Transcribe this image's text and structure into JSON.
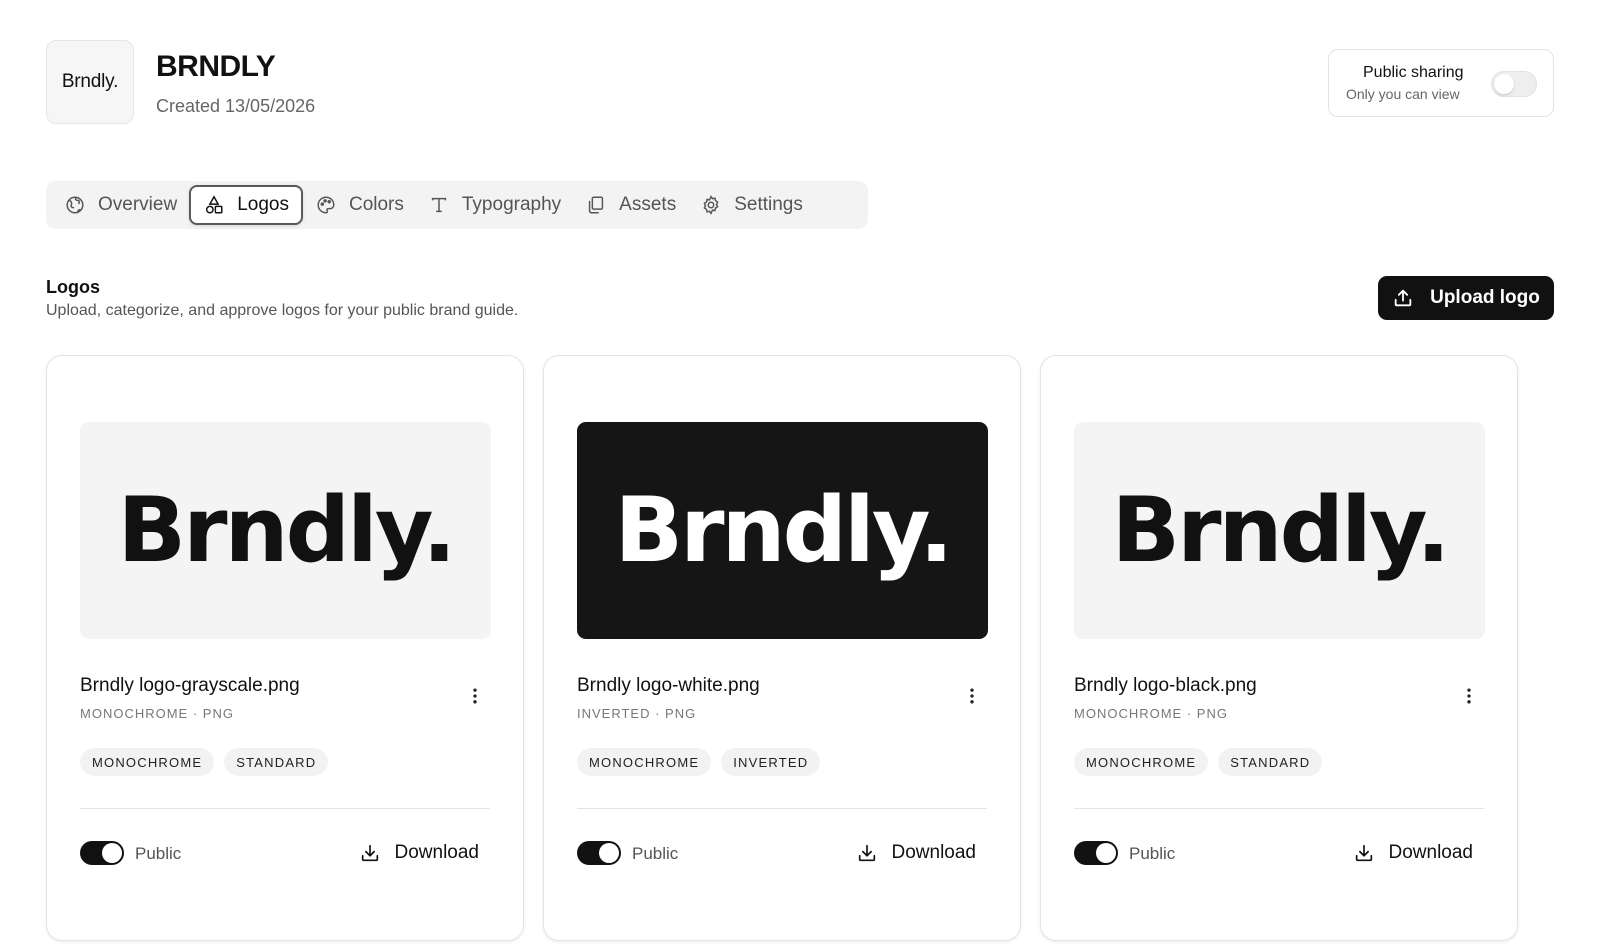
{
  "header": {
    "avatar_text": "Brndly.",
    "title": "BRNDLY",
    "created": "Created 13/05/2026"
  },
  "sharing": {
    "title": "Public sharing",
    "subtitle": "Only you can view",
    "enabled": false
  },
  "tabs": [
    {
      "label": "Overview",
      "icon": "globe-icon",
      "active": false
    },
    {
      "label": "Logos",
      "icon": "shapes-icon",
      "active": true
    },
    {
      "label": "Colors",
      "icon": "palette-icon",
      "active": false
    },
    {
      "label": "Typography",
      "icon": "type-icon",
      "active": false
    },
    {
      "label": "Assets",
      "icon": "copy-icon",
      "active": false
    },
    {
      "label": "Settings",
      "icon": "gear-icon",
      "active": false
    }
  ],
  "section": {
    "title": "Logos",
    "description": "Upload, categorize, and approve logos for your public brand guide.",
    "upload_label": "Upload logo"
  },
  "cards": [
    {
      "preview_text": "Brndly.",
      "preview_theme": "light",
      "file_name": "Brndly logo-grayscale.png",
      "meta": "MONOCHROME  · PNG",
      "tags": [
        "MONOCHROME",
        "STANDARD"
      ],
      "public_label": "Public",
      "public": true,
      "download_label": "Download"
    },
    {
      "preview_text": "Brndly.",
      "preview_theme": "dark",
      "file_name": "Brndly logo-white.png",
      "meta": "INVERTED  · PNG",
      "tags": [
        "MONOCHROME",
        "INVERTED"
      ],
      "public_label": "Public",
      "public": true,
      "download_label": "Download"
    },
    {
      "preview_text": "Brndly.",
      "preview_theme": "light",
      "file_name": "Brndly logo-black.png",
      "meta": "MONOCHROME  · PNG",
      "tags": [
        "MONOCHROME",
        "STANDARD"
      ],
      "public_label": "Public",
      "public": true,
      "download_label": "Download"
    }
  ],
  "colors": {
    "accent": "#111111",
    "muted_text": "#666666",
    "tab_bar": "#f3f3f3",
    "preview_light": "#f4f4f4",
    "preview_dark": "#151515"
  }
}
